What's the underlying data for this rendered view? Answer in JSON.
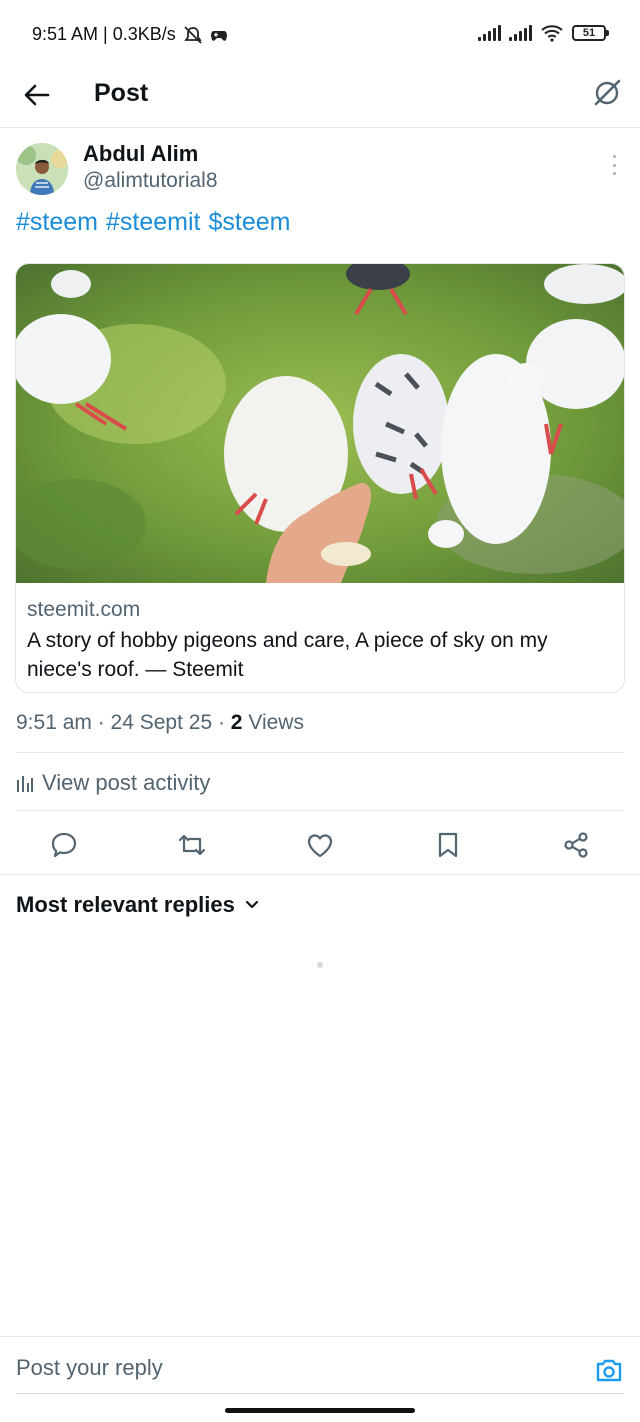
{
  "status_bar": {
    "time_and_speed": "9:51 AM | 0.3KB/s",
    "battery": "51"
  },
  "header": {
    "title": "Post",
    "back_icon": "arrow-left-icon",
    "grok_icon": "grok-icon"
  },
  "post": {
    "author_name": "Abdul Alim",
    "author_handle": "@alimtutorial8",
    "hashtags": [
      "#steem",
      "#steemit",
      "$steem"
    ],
    "link_card": {
      "domain": "steemit.com",
      "title": "A story of hobby pigeons and care, A piece of sky on my niece's roof. — Steemit"
    },
    "timestamp": "9:51 am · 24 Sept 25 · ",
    "views_count": "2",
    "views_label": " Views",
    "activity_label": "View post activity"
  },
  "actions": [
    "reply-icon",
    "repost-icon",
    "like-icon",
    "bookmark-icon",
    "share-icon"
  ],
  "replies": {
    "sort_label": "Most relevant replies"
  },
  "reply_bar": {
    "placeholder": "Post your reply"
  },
  "colors": {
    "accent": "#1d9bf0",
    "secondary_text": "#536471",
    "divider": "#e6e8eb"
  }
}
